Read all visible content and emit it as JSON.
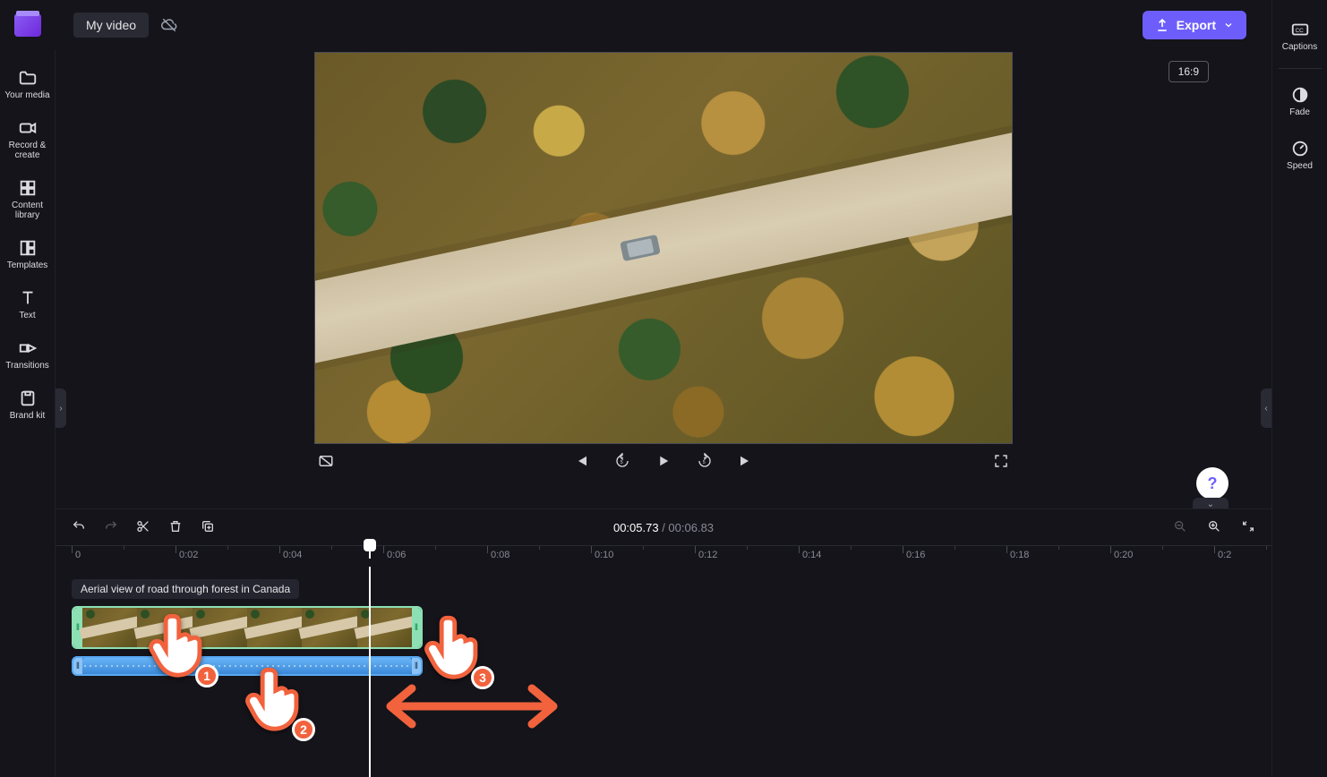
{
  "top": {
    "project_title": "My video",
    "export_label": "Export",
    "aspect_badge": "16:9"
  },
  "leftnav": {
    "items": [
      {
        "icon": "folder",
        "label": "Your media"
      },
      {
        "icon": "camera",
        "label": "Record & create"
      },
      {
        "icon": "boxes",
        "label": "Content library"
      },
      {
        "icon": "templates",
        "label": "Templates"
      },
      {
        "icon": "text",
        "label": "Text"
      },
      {
        "icon": "transitions",
        "label": "Transitions"
      },
      {
        "icon": "brand",
        "label": "Brand kit"
      }
    ]
  },
  "rightnav": {
    "items": [
      {
        "icon": "cc",
        "label": "Captions"
      },
      {
        "icon": "fade",
        "label": "Fade"
      },
      {
        "icon": "gauge",
        "label": "Speed"
      }
    ]
  },
  "playback": {
    "current": "00:05.73",
    "duration": "00:06.83"
  },
  "ruler": {
    "ticks": [
      "0",
      "0:02",
      "0:04",
      "0:06",
      "0:08",
      "0:10",
      "0:12",
      "0:14",
      "0:16",
      "0:18",
      "0:20",
      "0:2"
    ]
  },
  "clip": {
    "tooltip": "Aerial view of road through forest in Canada"
  },
  "annotations": {
    "nums": [
      "1",
      "2",
      "3"
    ]
  },
  "help_fab": "?"
}
